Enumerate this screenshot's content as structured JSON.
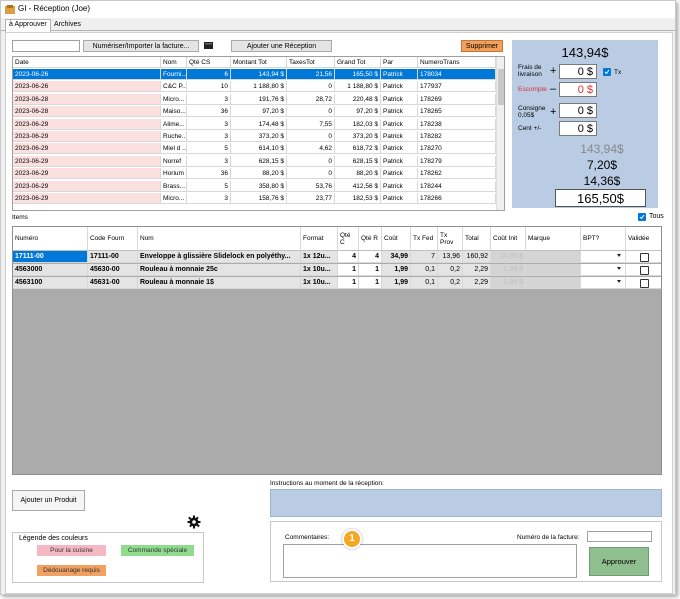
{
  "window": {
    "title": "GI - Réception (Joe)"
  },
  "tabs": [
    {
      "label": "à Approuver"
    },
    {
      "label": "Archives"
    }
  ],
  "toolbar": {
    "scan_label": "Numériser/Importer la facture...",
    "add_reception_label": "Ajouter une Réception",
    "delete_label": "Supprimer"
  },
  "receptions": {
    "columns": [
      "Date",
      "Nom",
      "Qté CS",
      "Montant Tot",
      "TaxesTot",
      "Grand Tot",
      "Par",
      "NumeroTrans"
    ],
    "rows": [
      [
        "2023-06-26",
        "Fourni...",
        "6",
        "143,94 $",
        "21,56",
        "165,50 $",
        "Patrick",
        "178034"
      ],
      [
        "2023-06-26",
        "C&C P...",
        "10",
        "1 188,80 $",
        "0",
        "1 188,80 $",
        "Patrick",
        "177937"
      ],
      [
        "2023-06-28",
        "Micro...",
        "3",
        "191,76 $",
        "28,72",
        "220,48 $",
        "Patrick",
        "178269"
      ],
      [
        "2023-06-28",
        "Maiso...",
        "36",
        "97,20 $",
        "0",
        "97,20 $",
        "Patrick",
        "178265"
      ],
      [
        "2023-06-29",
        "Alime...",
        "3",
        "174,48 $",
        "7,55",
        "182,03 $",
        "Patrick",
        "178238"
      ],
      [
        "2023-06-29",
        "Ruche...",
        "3",
        "373,20 $",
        "0",
        "373,20 $",
        "Patrick",
        "178282"
      ],
      [
        "2023-06-29",
        "Miel d ...",
        "5",
        "614,10 $",
        "4,62",
        "618,72 $",
        "Patrick",
        "178270"
      ],
      [
        "2023-06-29",
        "Norref",
        "3",
        "628,15 $",
        "0",
        "628,15 $",
        "Patrick",
        "178279"
      ],
      [
        "2023-06-29",
        "Horium",
        "36",
        "88,20 $",
        "0",
        "88,20 $",
        "Patrick",
        "178262"
      ],
      [
        "2023-06-29",
        "Brass...",
        "5",
        "358,80 $",
        "53,76",
        "412,56 $",
        "Patrick",
        "178244"
      ],
      [
        "2023-06-29",
        "Micro...",
        "3",
        "158,76 $",
        "23,77",
        "182,53 $",
        "Patrick",
        "178266"
      ]
    ]
  },
  "summary": {
    "total": "143,94$",
    "shipping_label": "Frais de livraison",
    "shipping_value": "0 $",
    "tx_label": "Tx",
    "discount_label": "Escompte",
    "discount_value": "0 $",
    "deposit_label": "Consigne 0,05$",
    "deposit_value": "0 $",
    "cent_label": "Cent +/-",
    "cent_value": "0 $",
    "subtotal": "143,94$",
    "taxes1": "7,20$",
    "taxes2": "14,36$",
    "grand_total": "165,50$",
    "plus_sign": "+",
    "minus_sign": "–"
  },
  "items": {
    "section_label": "Items",
    "all_label": "Tous",
    "columns": [
      "Numéro",
      "Code Fourn",
      "Nom",
      "Format",
      "Qté C",
      "Qté R",
      "Coût",
      "Tx Fed",
      "Tx Prov",
      "Total",
      "Coût Init",
      "Marque",
      "BPT?",
      "Validée"
    ],
    "rows": [
      [
        "17111-00",
        "17111-00",
        "Enveloppe à glissière Slidelock en polyéthy...",
        "1x 12u...",
        "4",
        "4",
        "34,99",
        "7",
        "13,96",
        "160,92",
        "34,99 $",
        "",
        "",
        ""
      ],
      [
        "4563000",
        "45630-00",
        "Rouleau à monnaie 25c",
        "1x 10u...",
        "1",
        "1",
        "1,99",
        "0,1",
        "0,2",
        "2,29",
        "1,99 $",
        "",
        "",
        ""
      ],
      [
        "4563100",
        "45631-00",
        "Rouleau à monnaie 1$",
        "1x 10u...",
        "1",
        "1",
        "1,99",
        "0,1",
        "0,2",
        "2,29",
        "1,99 $",
        "",
        "",
        ""
      ]
    ]
  },
  "bottom": {
    "add_product_label": "Ajouter un Produit",
    "instructions_label": "Instructions au moment de la réception:",
    "comments_label": "Commentaires:",
    "invoice_number_label": "Numéro de la facture:",
    "approve_label": "Approuver",
    "callout_number": "1"
  },
  "legend": {
    "title": "Légende des couleurs",
    "items": [
      {
        "label": "Pour la cuisine",
        "color": "#f4b8c4"
      },
      {
        "label": "Commande spéciale",
        "color": "#8fdc8f"
      },
      {
        "label": "Dédouanage requis",
        "color": "#f0a060"
      }
    ]
  },
  "colors": {
    "selection": "#0078d7",
    "delete_button": "#f5a05a",
    "summary_bg": "#b9cce4",
    "approve_button": "#8fbf8f",
    "callout": "#f5a623",
    "row_pink": "#fbe0e0",
    "discount_text": "#d9302b"
  }
}
